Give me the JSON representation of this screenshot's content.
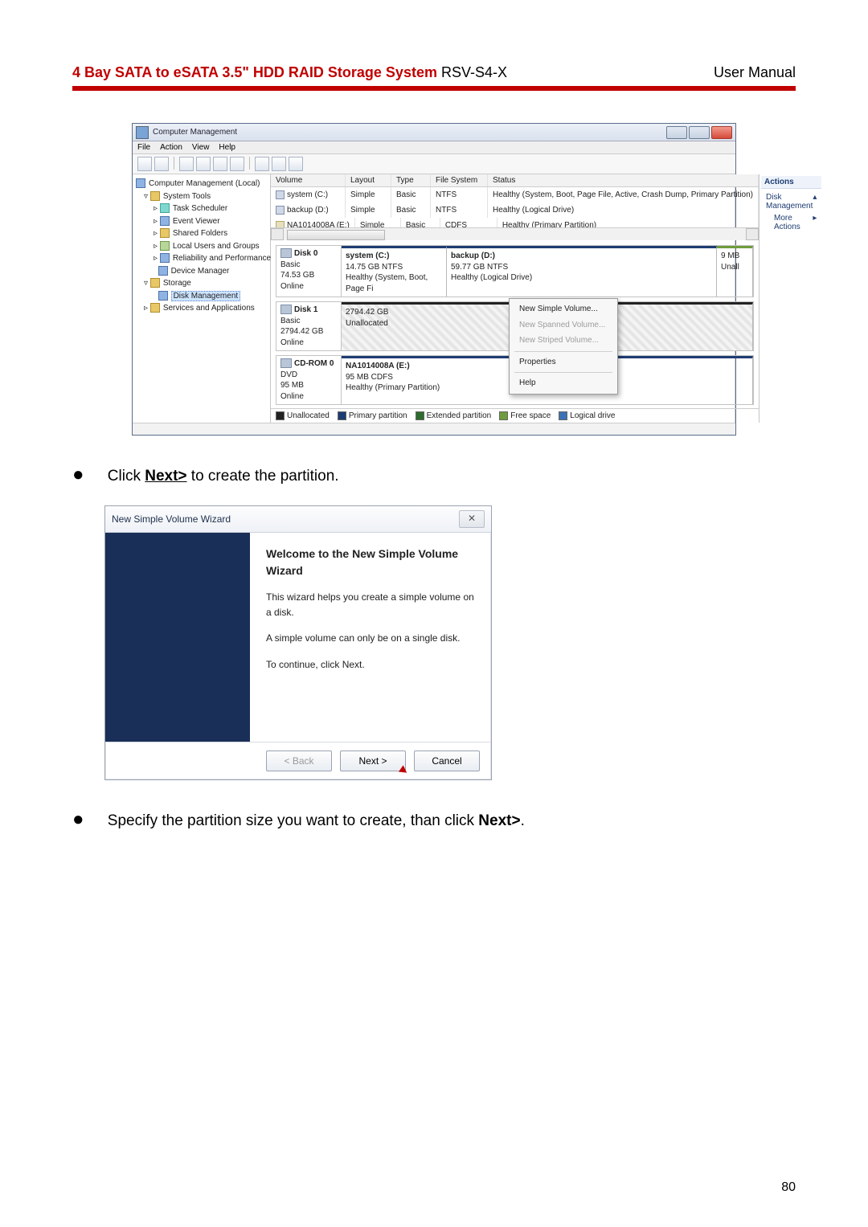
{
  "header": {
    "title_prefix": "4 Bay SATA to eSATA 3.5\" HDD RAID Storage System ",
    "model": "RSV-S4-X",
    "right": "User Manual"
  },
  "bullets": {
    "b1_pre": "Click ",
    "b1_link": "Next>",
    "b1_post": " to create the partition.",
    "b2_pre": "Specify the partition size you want to create, than click ",
    "b2_bold": "Next>",
    "b2_post": "."
  },
  "cm": {
    "title": "Computer Management",
    "menu": {
      "file": "File",
      "action": "Action",
      "view": "View",
      "help": "Help"
    },
    "tree": {
      "root": "Computer Management (Local)",
      "systools": "System Tools",
      "task": "Task Scheduler",
      "event": "Event Viewer",
      "shared": "Shared Folders",
      "users": "Local Users and Groups",
      "reliab": "Reliability and Performance",
      "devmgr": "Device Manager",
      "storage": "Storage",
      "diskmgmt": "Disk Management",
      "services": "Services and Applications"
    },
    "grid": {
      "h_volume": "Volume",
      "h_layout": "Layout",
      "h_type": "Type",
      "h_fs": "File System",
      "h_status": "Status",
      "r1": {
        "vol": "system (C:)",
        "layout": "Simple",
        "type": "Basic",
        "fs": "NTFS",
        "status": "Healthy (System, Boot, Page File, Active, Crash Dump, Primary Partition)"
      },
      "r2": {
        "vol": "backup (D:)",
        "layout": "Simple",
        "type": "Basic",
        "fs": "NTFS",
        "status": "Healthy (Logical Drive)"
      },
      "r3": {
        "vol": "NA1014008A (E:)",
        "layout": "Simple",
        "type": "Basic",
        "fs": "CDFS",
        "status": "Healthy (Primary Partition)"
      }
    },
    "disk0": {
      "head": "Disk 0",
      "type": "Basic",
      "size": "74.53 GB",
      "state": "Online",
      "sys": {
        "title": "system  (C:)",
        "l2": "14.75 GB NTFS",
        "l3": "Healthy (System, Boot, Page Fi"
      },
      "bak": {
        "title": "backup  (D:)",
        "l2": "59.77 GB NTFS",
        "l3": "Healthy (Logical Drive)"
      },
      "sm": {
        "l1": "9 MB",
        "l2": "Unall"
      }
    },
    "disk1": {
      "head": "Disk 1",
      "type": "Basic",
      "size": "2794.42 GB",
      "state": "Online",
      "un": {
        "l1": "2794.42 GB",
        "l2": "Unallocated"
      }
    },
    "cdrom": {
      "head": "CD-ROM 0",
      "type": "DVD",
      "size": "95 MB",
      "state": "Online",
      "p": {
        "title": "NA1014008A  (E:)",
        "l2": "95 MB CDFS",
        "l3": "Healthy (Primary Partition)"
      }
    },
    "ctx": {
      "i1": "New Simple Volume...",
      "i2": "New Spanned Volume...",
      "i3": "New Striped Volume...",
      "i4": "Properties",
      "i5": "Help"
    },
    "legend": {
      "un": "Unallocated",
      "pr": "Primary partition",
      "ex": "Extended partition",
      "fr": "Free space",
      "lo": "Logical drive"
    },
    "actions": {
      "head": "Actions",
      "l1": "Disk Management",
      "l2": "More Actions"
    }
  },
  "wizard": {
    "window_title": "New Simple Volume Wizard",
    "heading": "Welcome to the New Simple Volume Wizard",
    "p1": "This wizard helps you create a simple volume on a disk.",
    "p2": "A simple volume can only be on a single disk.",
    "p3": "To continue, click Next.",
    "back": "< Back",
    "next": "Next >",
    "cancel": "Cancel",
    "close_glyph": "✕"
  },
  "page_number": "80"
}
